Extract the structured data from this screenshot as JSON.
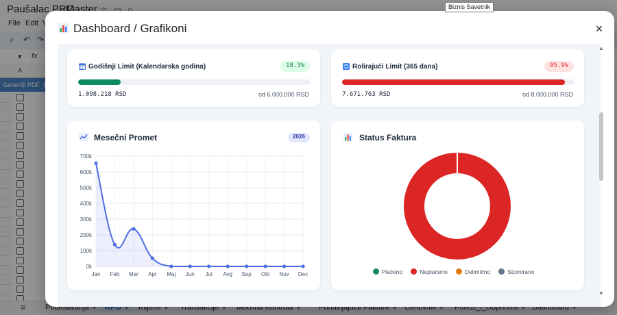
{
  "background": {
    "app_name": "Paušalac PRO",
    "app_subtitle": "Master",
    "menu": [
      "File",
      "Edit",
      "V"
    ],
    "column_header": "A",
    "header_cell": "Generiši PDF_P",
    "sheet_tabs": [
      {
        "label": "Podesavanja",
        "active": false
      },
      {
        "label": "KPO",
        "active": true
      },
      {
        "label": "Klijenti",
        "active": false
      },
      {
        "label": "Transakcije",
        "active": false
      },
      {
        "label": "Mobilna Kontrola",
        "active": false
      },
      {
        "label": "Ponavljajuce Fakture",
        "active": false
      },
      {
        "label": "Cenovnik",
        "active": false
      },
      {
        "label": "Porezi_i_Doprinosi",
        "active": false
      },
      {
        "label": "Dashboard",
        "active": false
      }
    ],
    "tooltip": "Biznis Savetnik"
  },
  "modal": {
    "title": "Dashboard / Grafikoni",
    "close_icon": "×"
  },
  "limit_cards": [
    {
      "title": "Godišnji Limit (Kalendarska godina)",
      "icon": "calendar-icon",
      "percent_label": "18.3%",
      "percent": 18.3,
      "amount": "1.098.218 RSD",
      "limit_label": "od 6.000.000 RSD",
      "color": "#0f8a5f",
      "badge_bg": "#dcfce7",
      "badge_color": "#15803d"
    },
    {
      "title": "Rolirajući Limit (365 dana)",
      "icon": "repeat-icon",
      "percent_label": "95.9%",
      "percent": 95.9,
      "amount": "7.671.763 RSD",
      "limit_label": "od 8.000.000 RSD",
      "color": "#dc2626",
      "badge_bg": "#fee2e2",
      "badge_color": "#dc2626"
    }
  ],
  "monthly": {
    "title": "Mesečni Promet",
    "icon": "line-chart-icon",
    "year": "2026"
  },
  "status": {
    "title": "Status Faktura",
    "icon": "bar-chart-icon"
  },
  "chart_data": [
    {
      "type": "line",
      "x": [
        "Jan",
        "Feb",
        "Mar",
        "Apr",
        "Maj",
        "Jun",
        "Jul",
        "Avg",
        "Sep",
        "Okt",
        "Nov",
        "Dec"
      ],
      "series": [
        {
          "values": [
            655000,
            138000,
            238000,
            52000,
            0,
            0,
            0,
            0,
            0,
            0,
            0,
            0
          ],
          "color": "#4f6de0"
        }
      ],
      "y_ticks": [
        "0k",
        "100k",
        "200k",
        "300k",
        "400k",
        "500k",
        "600k",
        "700k"
      ],
      "ylim": [
        0,
        700000
      ],
      "grid": true
    },
    {
      "type": "pie",
      "variant": "donut",
      "categories": [
        "Plaćeno",
        "Neplaćeno",
        "Delimično",
        "Stornirano"
      ],
      "values": [
        0,
        100,
        0,
        0
      ],
      "colors": [
        "#0f8a5f",
        "#dc2626",
        "#e07b12",
        "#64748b"
      ],
      "legend": "bottom"
    }
  ]
}
